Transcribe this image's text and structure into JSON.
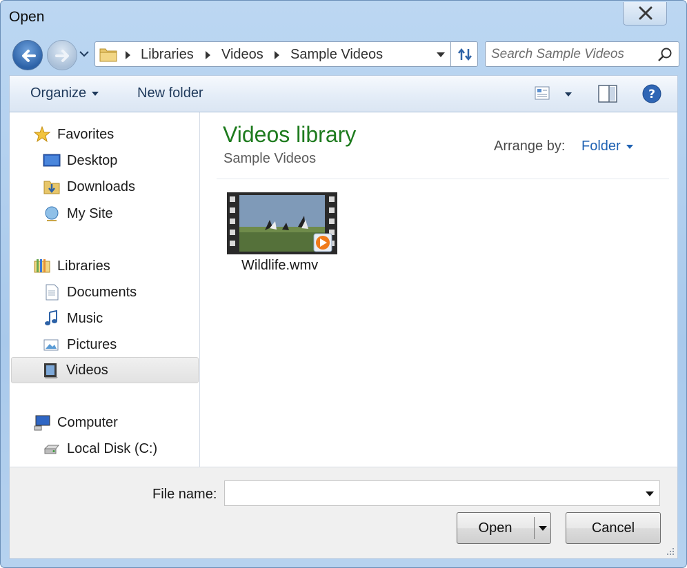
{
  "window": {
    "title": "Open"
  },
  "address": {
    "crumbs": [
      "Libraries",
      "Videos",
      "Sample Videos"
    ]
  },
  "search": {
    "placeholder": "Search Sample Videos"
  },
  "toolbar": {
    "organize": "Organize",
    "new_folder": "New folder"
  },
  "nav": {
    "favorites": {
      "header": "Favorites",
      "items": [
        "Desktop",
        "Downloads",
        "My Site"
      ]
    },
    "libraries": {
      "header": "Libraries",
      "items": [
        "Documents",
        "Music",
        "Pictures",
        "Videos"
      ],
      "selected": "Videos"
    },
    "computer": {
      "header": "Computer",
      "items": [
        "Local Disk (C:)"
      ]
    }
  },
  "content": {
    "title": "Videos library",
    "subtitle": "Sample Videos",
    "arrange_label": "Arrange by:",
    "arrange_value": "Folder",
    "files": [
      {
        "name": "Wildlife.wmv",
        "icon": "video-file-icon"
      }
    ]
  },
  "bottom": {
    "file_name_label": "File name:",
    "file_name_value": "",
    "open_label": "Open",
    "cancel_label": "Cancel"
  },
  "colors": {
    "library_title": "#1e7b1e",
    "link_blue": "#1f62b3",
    "frame": "#a9c9eb"
  }
}
